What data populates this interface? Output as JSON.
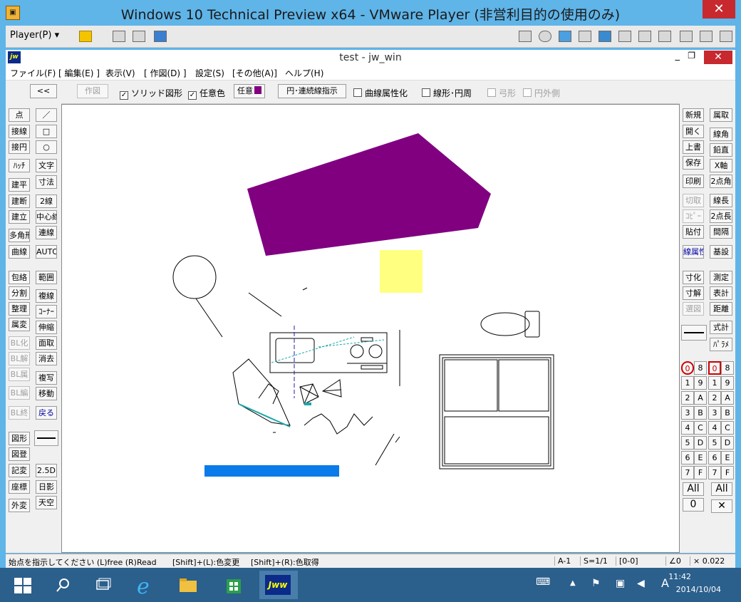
{
  "vm": {
    "title": "Windows 10 Technical Preview x64 - VMware Player (非営利目的の使用のみ)",
    "player_menu": "Player(P)",
    "close_glyph": "✕"
  },
  "jw": {
    "title": "test - jw_win",
    "logo": "jw",
    "min_glyph": "_",
    "max_glyph": "❐",
    "close_glyph": "✕",
    "menu": [
      "ファイル(F)",
      "[ 編集(E) ]",
      "表示(V)",
      "[ 作図(D) ]",
      "設定(S)",
      "[その他(A)]",
      "ヘルプ(H)"
    ],
    "options": {
      "back": "<<",
      "draw": "作図",
      "solid": "ソリッド図形",
      "solid_checked": "✓",
      "any_color": "任意色",
      "any_color_checked": "✓",
      "any_button": "任意",
      "any_swatch_color": "#800080",
      "arc_continuous": "円･連続線指示",
      "curve_attr": "曲線属性化",
      "line_arc": "線形･円周",
      "bow": "弓形",
      "outside_circle": "円外側"
    },
    "left_tools": [
      [
        "点",
        "／"
      ],
      [
        "接線",
        "□"
      ],
      [
        "接円",
        "○"
      ],
      [
        "ﾊｯﾁ",
        "文字"
      ],
      [
        "建平",
        "寸法"
      ],
      [
        "建断",
        "2線"
      ],
      [
        "建立",
        "中心線"
      ],
      [
        "多角形",
        "連線"
      ],
      [
        "曲線",
        "AUTO"
      ],
      [
        "包絡",
        "範囲"
      ],
      [
        "分割",
        "複線"
      ],
      [
        "整理",
        "ｺｰﾅｰ"
      ],
      [
        "属変",
        "伸縮"
      ],
      [
        "BL化",
        "面取"
      ],
      [
        "BL解",
        "消去"
      ],
      [
        "BL属",
        "複写"
      ],
      [
        "BL編",
        "移動"
      ],
      [
        "BL終",
        "戻る"
      ],
      [
        "図形",
        ""
      ],
      [
        "図登",
        ""
      ],
      [
        "記変",
        "2.5D"
      ],
      [
        "座標",
        "日影"
      ],
      [
        "外変",
        "天空"
      ]
    ],
    "right_tools": [
      [
        "新規",
        "属取"
      ],
      [
        "開く",
        "線角"
      ],
      [
        "上書",
        "鉛直"
      ],
      [
        "保存",
        "X軸"
      ],
      [
        "印刷",
        "2点角"
      ],
      [
        "切取",
        "線長"
      ],
      [
        "ｺﾋﾟｰ",
        "2点長"
      ],
      [
        "貼付",
        "間隔"
      ],
      [
        "線属性",
        "基設"
      ],
      [
        "寸化",
        "測定"
      ],
      [
        "寸解",
        "表計"
      ],
      [
        "選図",
        "距離"
      ],
      [
        "",
        "式計"
      ],
      [
        "",
        "ﾊﾟﾗﾒ"
      ]
    ],
    "layers_left": [
      "0",
      "8",
      "1",
      "9",
      "2",
      "A",
      "3",
      "B",
      "4",
      "C",
      "5",
      "D",
      "6",
      "E",
      "7",
      "F"
    ],
    "layers_right": [
      "0",
      "8",
      "1",
      "9",
      "2",
      "A",
      "3",
      "B",
      "4",
      "C",
      "5",
      "D",
      "6",
      "E",
      "7",
      "F"
    ],
    "layer_all": "All",
    "layer_zero": "0",
    "layer_x": "✕",
    "status": {
      "message": "始点を指示してください (L)free (R)Read",
      "shift_l": "[Shift]+(L):色変更",
      "shift_r": "[Shift]+(R):色取得",
      "layer": "A-1",
      "scale": "S=1/1",
      "group": "[0-0]",
      "angle": "∠0",
      "zoom": "× 0.022"
    },
    "colors": {
      "purple": "#800080",
      "yellow": "#ffff80",
      "blue": "#0a7be8",
      "teal": "#1aa8a8"
    }
  },
  "taskbar": {
    "time": "11:42",
    "date": "2014/10/04",
    "ime": "A",
    "app_label": "Jww"
  }
}
